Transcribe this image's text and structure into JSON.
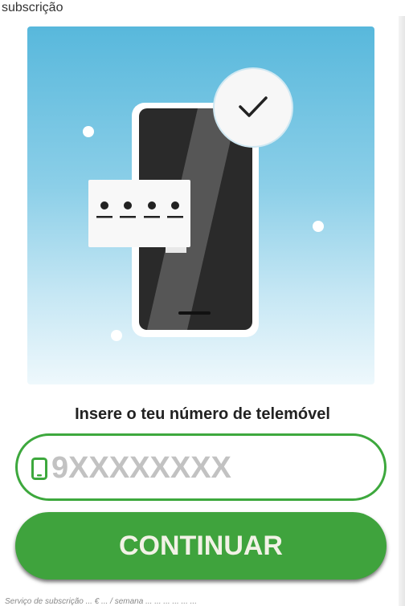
{
  "header": {
    "title": "subscrição"
  },
  "hero": {
    "illustration": "phone-verification-illustration",
    "code_dots": [
      "•",
      "•",
      "•",
      "•"
    ],
    "check_icon": "checkmark-icon"
  },
  "form": {
    "prompt": "Insere o teu número de telemóvel",
    "phone_placeholder": "9XXXXXXXX",
    "phone_icon": "mobile-phone-icon",
    "continue_label": "CONTINUAR"
  },
  "footer": {
    "note": "Serviço de subscrição ... € ... / semana ... ... ... ... ... ..."
  },
  "colors": {
    "accent": "#3fa33d",
    "hero_top": "#58b8dc",
    "hero_bottom": "#eef8fc",
    "phone_body": "#2a2a2a"
  }
}
